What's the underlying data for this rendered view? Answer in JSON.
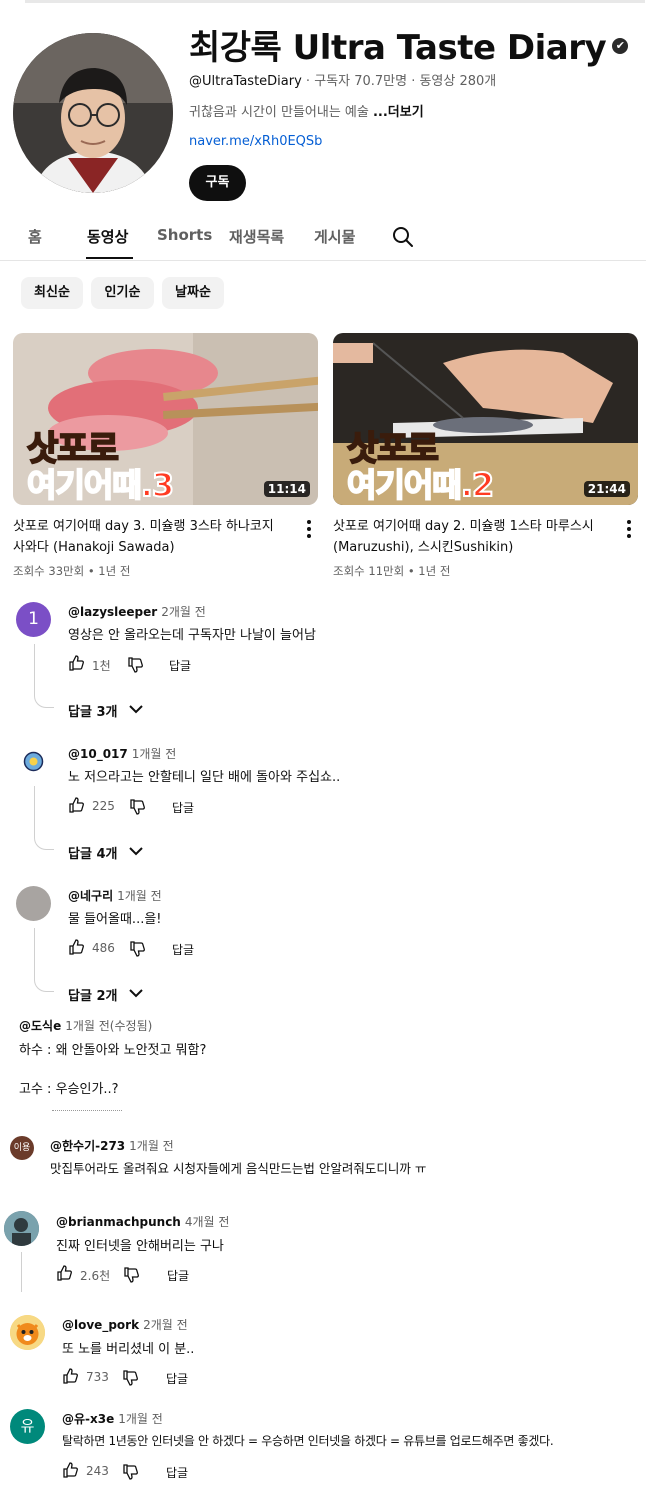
{
  "channel": {
    "name": "최강록 Ultra Taste Diary",
    "verified_mark": "✔",
    "handle": "@UltraTasteDiary",
    "stats": " · 구독자 70.7만명 · 동영상 280개",
    "description": "귀찮음과 시간이 만들어내는 예술 ",
    "more": "...더보기",
    "link": "naver.me/xRh0EQSb",
    "subscribe_label": "구독"
  },
  "tabs": [
    {
      "label": "홈"
    },
    {
      "label": "동영상"
    },
    {
      "label": "Shorts"
    },
    {
      "label": "재생목록"
    },
    {
      "label": "게시물"
    }
  ],
  "active_tab": "동영상",
  "icons": {
    "search": "search-icon",
    "kebab": "more-vert-icon",
    "like": "thumbs-up-icon",
    "dislike": "thumbs-down-icon",
    "chevron": "chevron-down-icon"
  },
  "chips": [
    {
      "label": "최신순"
    },
    {
      "label": "인기순"
    },
    {
      "label": "날짜순"
    }
  ],
  "videos": [
    {
      "thumb_line1": "삿포로",
      "thumb_line2": "여기어때.3",
      "duration": "11:14",
      "title_line1": "삿포로 여기어때 day 3. 미슐랭 3스타 하나코지",
      "title_line2": "사와다 (Hanakoji Sawada)",
      "meta": "조회수 33만회 • 1년 전"
    },
    {
      "thumb_line1": "삿포로",
      "thumb_line2": "여기어때.2",
      "duration": "21:44",
      "title_line1": "삿포로 여기어때 day 2. 미슐랭 1스타 마루스시",
      "title_line2": "(Maruzushi), 스시킨Sushikin)",
      "meta": "조회수 11만회 • 1년 전"
    }
  ],
  "comments": [
    {
      "avatar_letter": "1",
      "author": "@lazysleeper",
      "time": "2개월 전",
      "text": "영상은 안 올라오는데 구독자만 나날이 늘어남",
      "likes": "1천",
      "reply_label": "답글",
      "replies": "답글 3개"
    },
    {
      "avatar_letter": "",
      "author": "@10_017",
      "time": "1개월 전",
      "text": "노 저으라고는 안할테니 일단 배에 돌아와 주십쇼..",
      "likes": "225",
      "reply_label": "답글",
      "replies": "답글 4개"
    },
    {
      "avatar_letter": "",
      "author": "@네구리",
      "time": "1개월 전",
      "text": "물 들어올때...을!",
      "likes": "486",
      "reply_label": "답글",
      "replies": "답글 2개"
    },
    {
      "author": "@도식e",
      "time": "1개월 전(수정됨)",
      "text_line1": "하수 : 왜 안돌아와 노안젓고 뭐함?",
      "text_line2": "고수 : 우승인가..?"
    },
    {
      "avatar_letter": "이용",
      "author": "@한수기-273",
      "time": "1개월 전",
      "text": "맛집투어라도 올려줘요 시청자들에게 음식만드는법 안알려줘도디니까 ㅠ"
    },
    {
      "avatar_letter": "",
      "author": "@brianmachpunch",
      "time": "4개월 전",
      "text": "진짜 인터넷을 안해버리는 구나",
      "likes": "2.6천",
      "reply_label": "답글"
    },
    {
      "avatar_letter": "",
      "author": "@love_pork",
      "time": "2개월 전",
      "text": "또 노를 버리셨네 이 분..",
      "likes": "733",
      "reply_label": "답글"
    },
    {
      "avatar_letter": "유",
      "author": "@유-x3e",
      "time": "1개월 전",
      "text": "탈락하면 1년동안 인터넷을 안 하겠다 = 우승하면 인터넷을 하겠다 = 유튜브를 업로드해주면 좋겠다.",
      "likes": "243",
      "reply_label": "답글"
    }
  ]
}
